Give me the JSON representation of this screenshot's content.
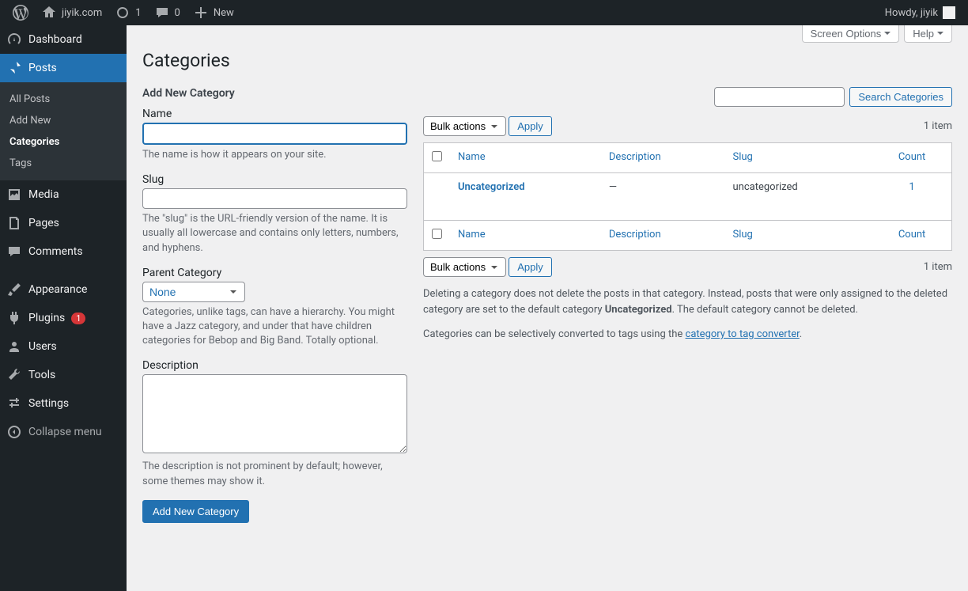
{
  "adminbar": {
    "site_name": "jiyik.com",
    "updates_count": "1",
    "comments_count": "0",
    "new_label": "New",
    "howdy": "Howdy, jiyik"
  },
  "sidebar": {
    "dashboard": "Dashboard",
    "posts": "Posts",
    "posts_sub": {
      "all": "All Posts",
      "add": "Add New",
      "categories": "Categories",
      "tags": "Tags"
    },
    "media": "Media",
    "pages": "Pages",
    "comments": "Comments",
    "appearance": "Appearance",
    "plugins": "Plugins",
    "plugins_badge": "1",
    "users": "Users",
    "tools": "Tools",
    "settings": "Settings",
    "collapse": "Collapse menu"
  },
  "screen": {
    "options": "Screen Options",
    "help": "Help"
  },
  "page": {
    "title": "Categories"
  },
  "form": {
    "heading": "Add New Category",
    "name_label": "Name",
    "name_desc": "The name is how it appears on your site.",
    "slug_label": "Slug",
    "slug_desc": "The \"slug\" is the URL-friendly version of the name. It is usually all lowercase and contains only letters, numbers, and hyphens.",
    "parent_label": "Parent Category",
    "parent_value": "None",
    "parent_desc": "Categories, unlike tags, can have a hierarchy. You might have a Jazz category, and under that have children categories for Bebop and Big Band. Totally optional.",
    "desc_label": "Description",
    "desc_desc": "The description is not prominent by default; however, some themes may show it.",
    "submit": "Add New Category"
  },
  "list": {
    "search_button": "Search Categories",
    "bulk_actions": "Bulk actions",
    "apply": "Apply",
    "item_count": "1 item",
    "cols": {
      "name": "Name",
      "description": "Description",
      "slug": "Slug",
      "count": "Count"
    },
    "rows": [
      {
        "name": "Uncategorized",
        "description": "—",
        "slug": "uncategorized",
        "count": "1"
      }
    ],
    "note_part1": "Deleting a category does not delete the posts in that category. Instead, posts that were only assigned to the deleted category are set to the default category ",
    "note_bold": "Uncategorized",
    "note_part2": ". The default category cannot be deleted.",
    "note2_part1": "Categories can be selectively converted to tags using the ",
    "note2_link": "category to tag converter",
    "note2_part2": "."
  }
}
